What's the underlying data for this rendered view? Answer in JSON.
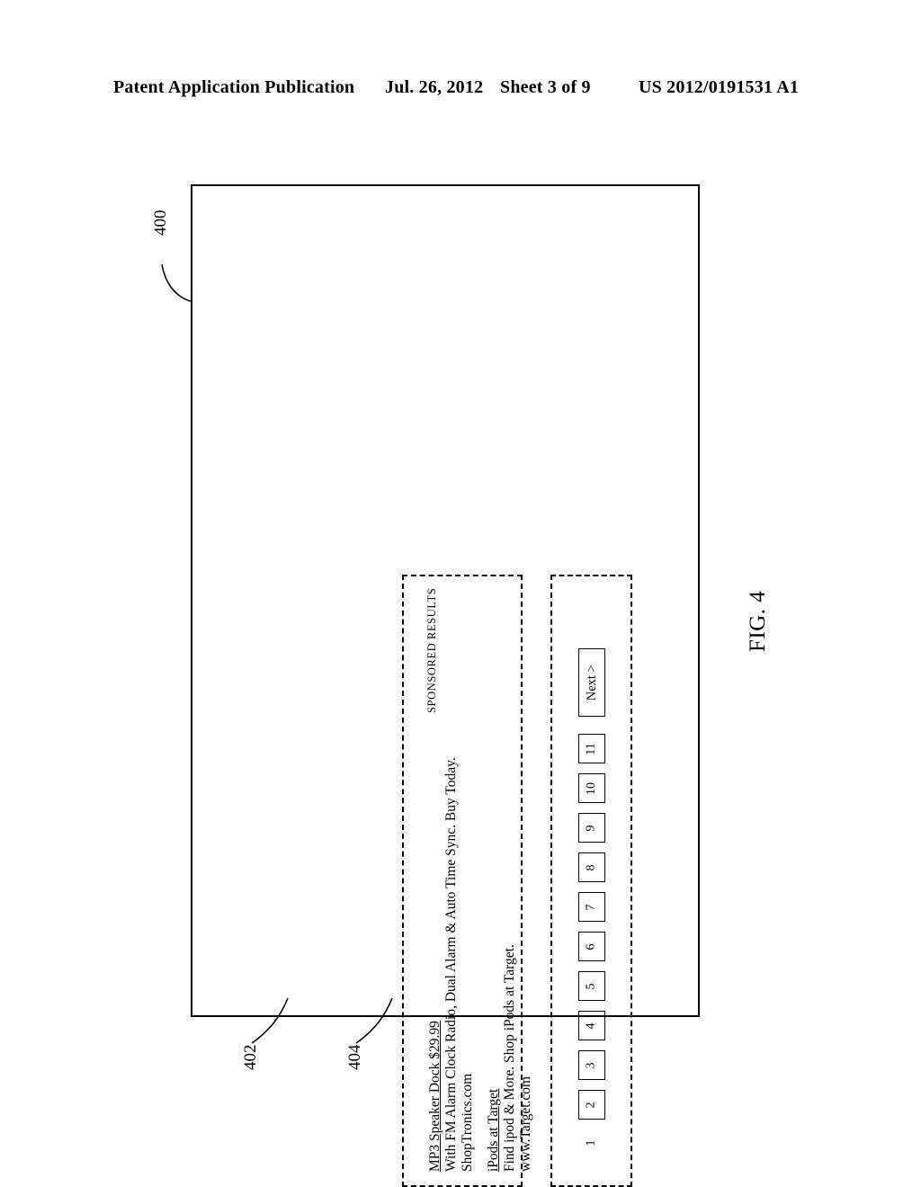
{
  "header": {
    "publication": "Patent Application Publication",
    "date": "Jul. 26, 2012",
    "sheet": "Sheet 3 of 9",
    "patent_number": "US 2012/0191531 A1"
  },
  "figure": {
    "caption": "FIG. 4",
    "screen_ref": "400",
    "sponsored_region_ref": "402",
    "pagination_region_ref": "404"
  },
  "sponsored": {
    "section_label": "SPONSORED RESULTS",
    "ads": [
      {
        "title": "MP3 Speaker Dock $29.99",
        "description": "With FM Alarm Clock Radio, Dual Alarm & Auto Time Sync. Buy Today.",
        "url": "ShopTronics.com"
      },
      {
        "title": "iPods at Target",
        "description": "Find ipod & More. Shop iPods at Target.",
        "url": "www.Target.com"
      }
    ]
  },
  "pagination": {
    "current_page": "1",
    "pages": [
      "1",
      "2",
      "3",
      "4",
      "5",
      "6",
      "7",
      "8",
      "9",
      "10",
      "11"
    ],
    "next_label": "Next >"
  }
}
